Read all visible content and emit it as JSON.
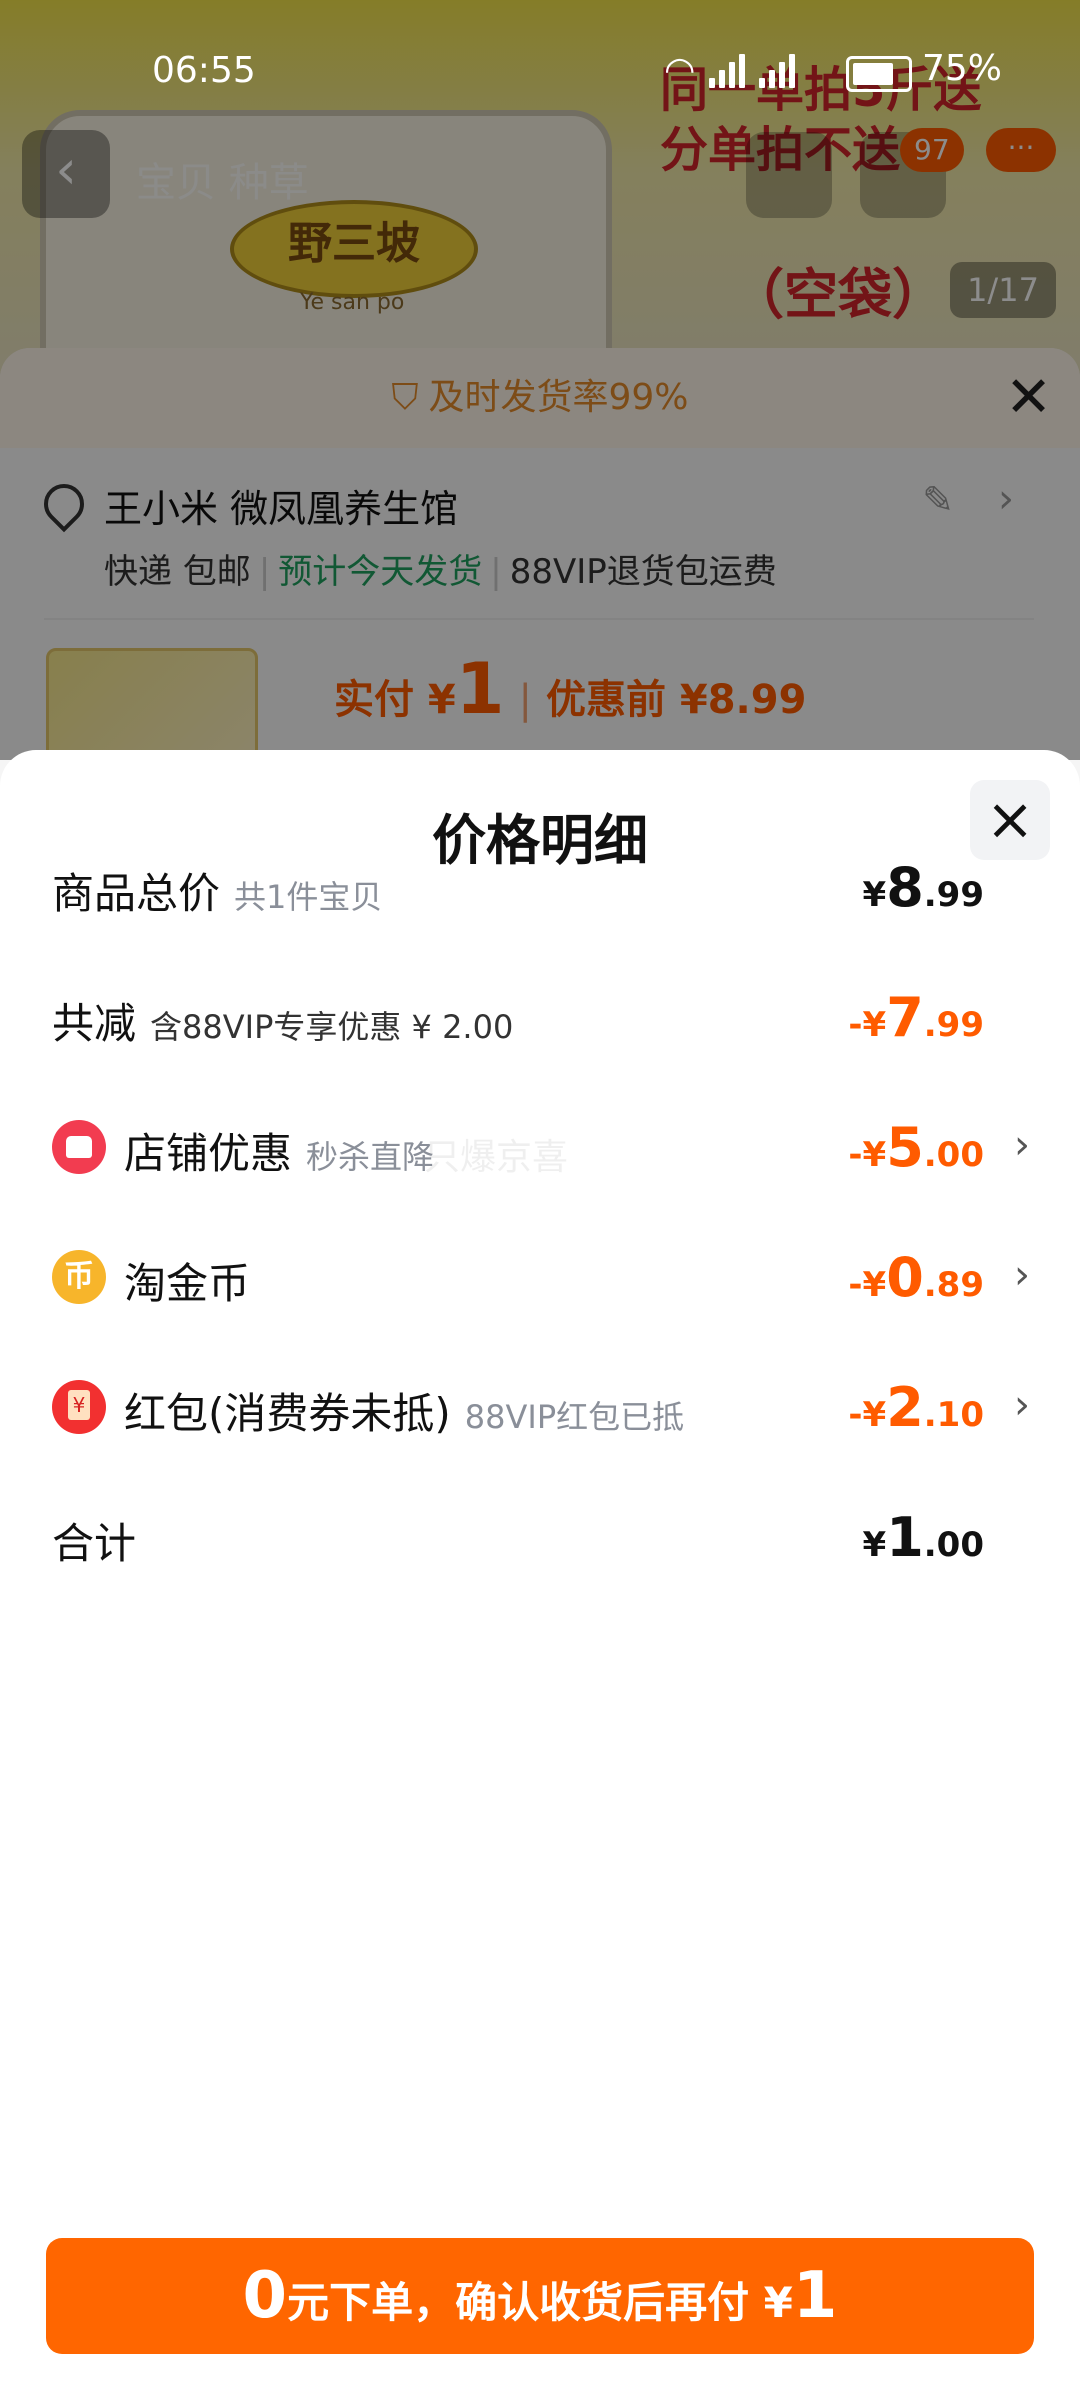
{
  "status_bar": {
    "time": "06:55",
    "network_1": "5G",
    "network_2": "5G",
    "battery": "75%"
  },
  "background": {
    "nav_tab_text": "宝贝  种草",
    "cart_count": "97",
    "more": "···",
    "image_pager": "1/17",
    "brand_label": "野三坡",
    "brand_sub": "Ye san po",
    "promo_text_line1": "同一单拍5斤送",
    "promo_text_line2": "分单拍不送",
    "promo_text_empty_bag": "（空袋）",
    "shipping_banner": "及时发货率99%",
    "address_name": "王小米 微凤凰养生馆",
    "ship_method": "快递 包邮",
    "ship_eta": "预计今天发货",
    "return_policy": "88VIP退货包运费",
    "paid_label": "实付 ¥",
    "paid_amount": "1",
    "before_discount": "优惠前 ¥8.99"
  },
  "sheet": {
    "title": "价格明细",
    "rows": [
      {
        "label": "商品总价",
        "sub": "共1件宝贝",
        "currency": "¥",
        "int": "8",
        "dec": ".99"
      },
      {
        "label": "共减",
        "sub": "含88VIP专享优惠 ¥ 2.00",
        "currency": "-¥",
        "int": "7",
        "dec": ".99"
      },
      {
        "label": "店铺优惠",
        "sub": "秒杀直降",
        "currency": "-¥",
        "int": "5",
        "dec": ".00",
        "icon": "shop-icon"
      },
      {
        "label": "淘金币",
        "sub": "",
        "currency": "-¥",
        "int": "0",
        "dec": ".89",
        "icon": "coin-icon",
        "icon_glyph": "币"
      },
      {
        "label": "红包(消费券未抵)",
        "sub": "88VIP红包已抵",
        "currency": "-¥",
        "int": "2",
        "dec": ".10",
        "icon": "red-packet-icon"
      },
      {
        "label": "合计",
        "sub": "",
        "currency": "¥",
        "int": "1",
        "dec": ".00"
      }
    ],
    "watermark": "只爆京喜"
  },
  "pay_button": {
    "prefix": "0",
    "text": "元下单，确认收货后再付 ¥",
    "amount": "1"
  },
  "colors": {
    "accent": "#ff6600",
    "discount": "#ff5b00",
    "green": "#20a060"
  }
}
